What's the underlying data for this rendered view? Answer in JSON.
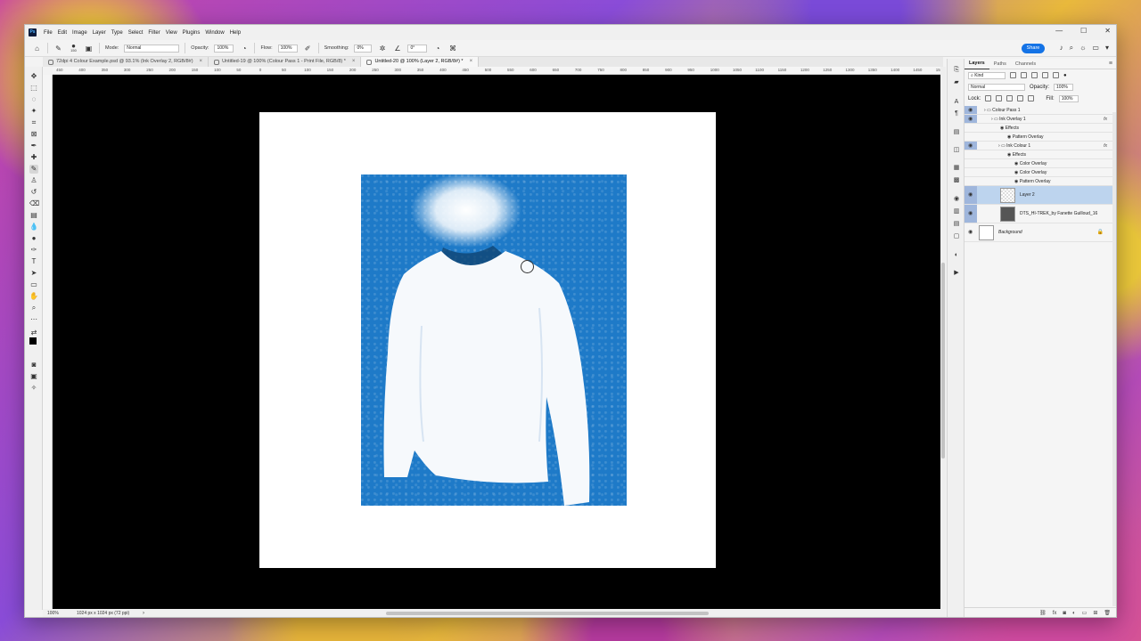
{
  "app": {
    "logo": "Ps"
  },
  "menu": [
    "File",
    "Edit",
    "Image",
    "Layer",
    "Type",
    "Select",
    "Filter",
    "View",
    "Plugins",
    "Window",
    "Help"
  ],
  "window_controls": [
    "—",
    "☐",
    "✕"
  ],
  "options": {
    "brush_size": "150",
    "mode_label": "Mode:",
    "mode_value": "Normal",
    "opacity_label": "Opacity:",
    "opacity_value": "100%",
    "flow_label": "Flow:",
    "flow_value": "100%",
    "smoothing_label": "Smoothing:",
    "smoothing_value": "0%",
    "angle_value": "0°",
    "share_label": "Share"
  },
  "tabs": [
    {
      "label": "72dpi 4 Colour Example.psd @ 93.1% (Ink Overlay 2, RGB/8#)",
      "active": false
    },
    {
      "label": "Untitled-19 @ 100% (Colour Pass 1 - Print File, RGB/8) *",
      "active": false
    },
    {
      "label": "Untitled-20 @ 100% (Layer 2, RGB/8#) *",
      "active": true
    }
  ],
  "ruler_ticks": [
    "450",
    "400",
    "350",
    "300",
    "250",
    "200",
    "150",
    "100",
    "50",
    "0",
    "50",
    "100",
    "150",
    "200",
    "250",
    "300",
    "350",
    "400",
    "450",
    "500",
    "550",
    "600",
    "650",
    "700",
    "750",
    "800",
    "850",
    "900",
    "950",
    "1000",
    "1050",
    "1100",
    "1150",
    "1200",
    "1250",
    "1300",
    "1350",
    "1400",
    "1450",
    "1500"
  ],
  "status": {
    "zoom": "100%",
    "dims": "1024 px x 1024 px (72 ppi)",
    "arrow": "›"
  },
  "layers_panel": {
    "tabs": [
      "Layers",
      "Paths",
      "Channels"
    ],
    "filter_kind": "Kind",
    "blend_mode": "Normal",
    "opacity_label": "Opacity:",
    "opacity_value": "100%",
    "lock_label": "Lock:",
    "fill_label": "Fill:",
    "fill_value": "100%",
    "rows": [
      {
        "name": "Colour Pass 1",
        "indent": 22,
        "type": "group"
      },
      {
        "name": "Ink Overlay 1",
        "indent": 30,
        "type": "group",
        "fx": "fx"
      },
      {
        "name": "Effects",
        "indent": 40,
        "type": "effect"
      },
      {
        "name": "Pattern Overlay",
        "indent": 48,
        "type": "effect"
      },
      {
        "name": "Ink Colour 1",
        "indent": 38,
        "type": "group",
        "fx": "fx"
      },
      {
        "name": "Effects",
        "indent": 48,
        "type": "effect"
      },
      {
        "name": "Color Overlay",
        "indent": 56,
        "type": "effect"
      },
      {
        "name": "Color Overlay",
        "indent": 56,
        "type": "effect"
      },
      {
        "name": "Pattern Overlay",
        "indent": 56,
        "type": "effect"
      },
      {
        "name": "Layer 2",
        "indent": 56,
        "type": "layer",
        "selected": true
      },
      {
        "name": "DTS_HI-TREK_by Fanette Guilloud_16",
        "indent": 56,
        "type": "photo"
      },
      {
        "name": "Background",
        "indent": 32,
        "type": "background"
      }
    ]
  },
  "colors": {
    "accent": "#1473e6",
    "canvas_bg": "#000000",
    "art_blue": "#1e7ac8",
    "selection": "#bdd4ee"
  }
}
